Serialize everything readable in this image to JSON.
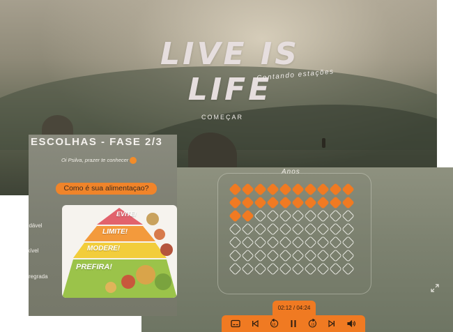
{
  "hero": {
    "title": "LIVE IS LIFE",
    "subtitle": "Contando estações",
    "start_label": "COMEÇAR"
  },
  "choices_card": {
    "phase_title": "ESCOLHAS - FASE 2/3",
    "greeting": "Oi Psilva, prazer te conhecer",
    "question": "Como é sua alimentaçao?",
    "options": [
      "udável",
      "xível",
      "sregrada"
    ],
    "pyramid_tiers": [
      "EVITE!",
      "LIMITE!",
      "MODERE!",
      "PREFIRA!"
    ]
  },
  "years_card": {
    "label": "Anos",
    "total_cells": 70,
    "filled_cells": 22
  },
  "player": {
    "current_time": "02:12",
    "separator": "/",
    "total_time": "04:24",
    "controls": [
      "subtitles-icon",
      "skip-back-icon",
      "rewind-15-icon",
      "pause-icon",
      "forward-15-icon",
      "skip-forward-icon",
      "volume-icon"
    ]
  },
  "colors": {
    "accent": "#f07a22",
    "evite": "#e2626c",
    "limite": "#f39a3c",
    "modere": "#f2cd3b",
    "prefira": "#9bc34a"
  }
}
